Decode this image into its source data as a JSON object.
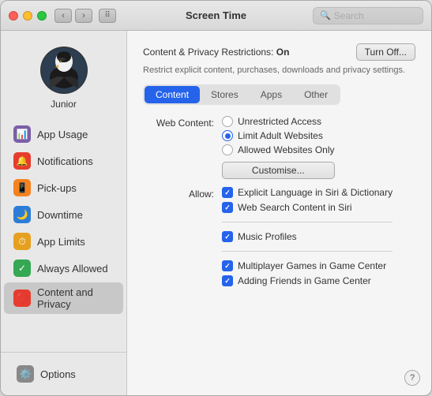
{
  "window": {
    "title": "Screen Time"
  },
  "titlebar": {
    "search_placeholder": "Search",
    "nav_back": "‹",
    "nav_forward": "›",
    "grid": "⠿"
  },
  "sidebar": {
    "user_name": "Junior",
    "items": [
      {
        "id": "app-usage",
        "label": "App Usage",
        "icon": "📊",
        "icon_color": "icon-purple"
      },
      {
        "id": "notifications",
        "label": "Notifications",
        "icon": "🔔",
        "icon_color": "icon-red"
      },
      {
        "id": "pick-ups",
        "label": "Pick-ups",
        "icon": "📱",
        "icon_color": "icon-orange"
      },
      {
        "id": "downtime",
        "label": "Downtime",
        "icon": "🌙",
        "icon_color": "icon-blue"
      },
      {
        "id": "app-limits",
        "label": "App Limits",
        "icon": "⏱",
        "icon_color": "icon-yellow"
      },
      {
        "id": "always-allowed",
        "label": "Always Allowed",
        "icon": "✓",
        "icon_color": "icon-green"
      },
      {
        "id": "content-privacy",
        "label": "Content and Privacy",
        "icon": "🚫",
        "icon_color": "icon-red2"
      }
    ],
    "footer_item": "Options"
  },
  "main": {
    "header_label": "Content & Privacy Restrictions:",
    "header_status": "On",
    "turn_off_label": "Turn Off...",
    "subtitle": "Restrict explicit content, purchases, downloads and privacy settings.",
    "tabs": [
      {
        "id": "content",
        "label": "Content"
      },
      {
        "id": "stores",
        "label": "Stores"
      },
      {
        "id": "apps",
        "label": "Apps"
      },
      {
        "id": "other",
        "label": "Other"
      }
    ],
    "active_tab": "content",
    "web_content_label": "Web Content:",
    "web_content_options": [
      {
        "id": "unrestricted",
        "label": "Unrestricted Access",
        "selected": false
      },
      {
        "id": "limit-adult",
        "label": "Limit Adult Websites",
        "selected": true
      },
      {
        "id": "allowed-only",
        "label": "Allowed Websites Only",
        "selected": false
      }
    ],
    "customise_label": "Customise...",
    "allow_label": "Allow:",
    "allow_items_group1": [
      {
        "id": "explicit-siri",
        "label": "Explicit Language in Siri & Dictionary",
        "checked": true
      },
      {
        "id": "web-search-siri",
        "label": "Web Search Content in Siri",
        "checked": true
      }
    ],
    "allow_items_group2": [
      {
        "id": "music-profiles",
        "label": "Music Profiles",
        "checked": true
      }
    ],
    "allow_items_group3": [
      {
        "id": "multiplayer-games",
        "label": "Multiplayer Games in Game Center",
        "checked": true
      },
      {
        "id": "adding-friends",
        "label": "Adding Friends in Game Center",
        "checked": true
      }
    ],
    "help_label": "?"
  }
}
